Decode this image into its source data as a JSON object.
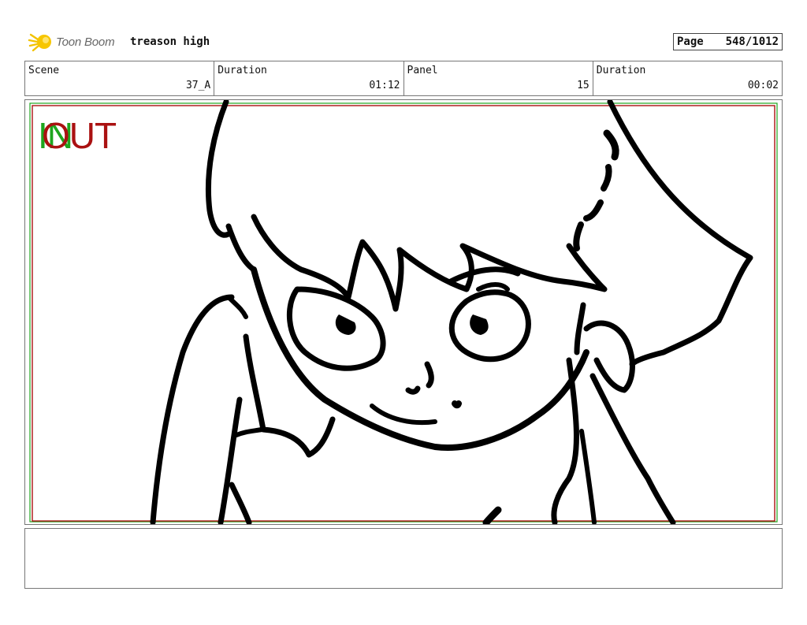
{
  "header": {
    "logo_text": "Toon Boom",
    "project_title": "treason high",
    "page_label": "Page",
    "page_value": "548/1012"
  },
  "info": [
    {
      "label": "Scene",
      "value": "37_A"
    },
    {
      "label": "Duration",
      "value": "01:12"
    },
    {
      "label": "Panel",
      "value": "15"
    },
    {
      "label": "Duration",
      "value": "00:02"
    }
  ],
  "panel": {
    "in_marker": "IN",
    "out_marker": "OUT",
    "colors": {
      "in": "#1ea51e",
      "out": "#aa1111",
      "frame_outer": "#1ea51e",
      "frame_inner": "#aa1111"
    }
  },
  "notes": ""
}
